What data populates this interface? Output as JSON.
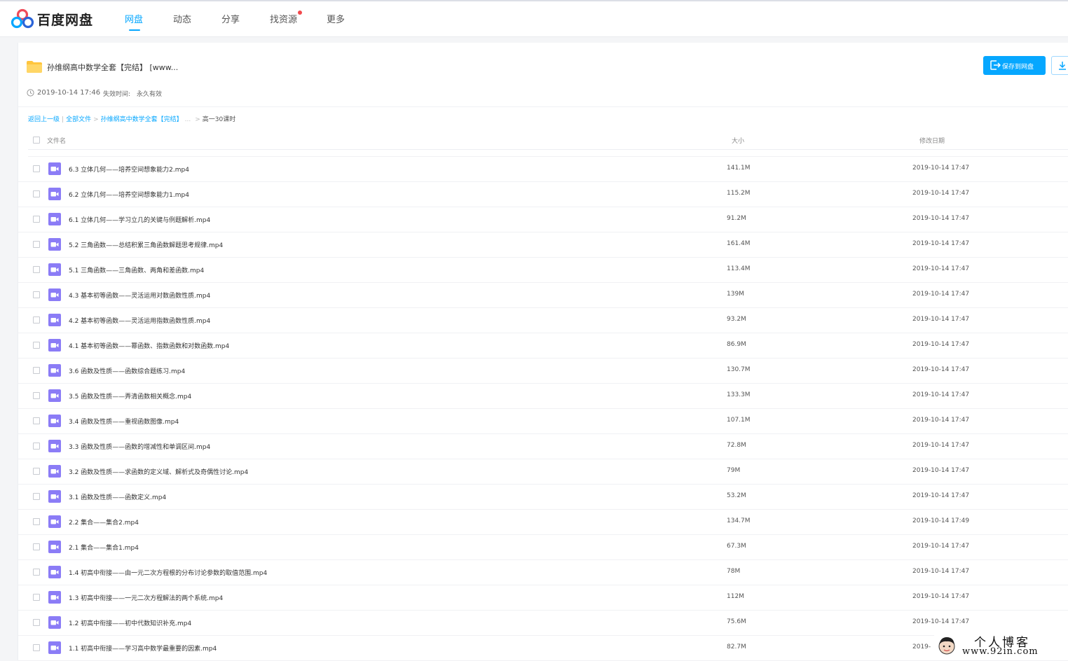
{
  "header": {
    "brand": "百度网盘",
    "nav": [
      {
        "label": "网盘",
        "active": true
      },
      {
        "label": "动态",
        "active": false
      },
      {
        "label": "分享",
        "active": false
      },
      {
        "label": "找资源",
        "active": false,
        "badge_dot": true
      },
      {
        "label": "更多",
        "active": false
      }
    ]
  },
  "share": {
    "title": "孙维纲高中数学全套【完结】 [www...",
    "date": "2019-10-14 17:46",
    "expire_label": "失效时间:",
    "expire_value": "永久有效",
    "save_button": "保存到网盘"
  },
  "breadcrumb": {
    "back": "返回上一级",
    "all": "全部文件",
    "folder": "孙维纲高中数学全套【完结】",
    "ellipsis": "...",
    "current": "高一30课时"
  },
  "columns": {
    "name": "文件名",
    "size": "大小",
    "date": "修改日期"
  },
  "files": [
    {
      "name": "6.3 立体几何——培养空间想象能力2.mp4",
      "size": "141.1M",
      "date": "2019-10-14 17:47"
    },
    {
      "name": "6.2 立体几何——培养空间想象能力1.mp4",
      "size": "115.2M",
      "date": "2019-10-14 17:47"
    },
    {
      "name": "6.1 立体几何——学习立几的关键与例题解析.mp4",
      "size": "91.2M",
      "date": "2019-10-14 17:47"
    },
    {
      "name": "5.2 三角函数——总结积累三角函数解题思考规律.mp4",
      "size": "161.4M",
      "date": "2019-10-14 17:47"
    },
    {
      "name": "5.1 三角函数——三角函数、两角和差函数.mp4",
      "size": "113.4M",
      "date": "2019-10-14 17:47"
    },
    {
      "name": "4.3 基本初等函数——灵活运用对数函数性质.mp4",
      "size": "139M",
      "date": "2019-10-14 17:47"
    },
    {
      "name": "4.2 基本初等函数——灵活运用指数函数性质.mp4",
      "size": "93.2M",
      "date": "2019-10-14 17:47"
    },
    {
      "name": "4.1 基本初等函数——幂函数、指数函数和对数函数.mp4",
      "size": "86.9M",
      "date": "2019-10-14 17:47"
    },
    {
      "name": "3.6 函数及性质——函数综合题练习.mp4",
      "size": "130.7M",
      "date": "2019-10-14 17:47"
    },
    {
      "name": "3.5 函数及性质——弄清函数相关概念.mp4",
      "size": "133.3M",
      "date": "2019-10-14 17:47"
    },
    {
      "name": "3.4 函数及性质——重视函数图像.mp4",
      "size": "107.1M",
      "date": "2019-10-14 17:47"
    },
    {
      "name": "3.3 函数及性质——函数的增减性和单调区间.mp4",
      "size": "72.8M",
      "date": "2019-10-14 17:47"
    },
    {
      "name": "3.2 函数及性质——求函数的定义域、解析式及奇偶性讨论.mp4",
      "size": "79M",
      "date": "2019-10-14 17:47"
    },
    {
      "name": "3.1 函数及性质——函数定义.mp4",
      "size": "53.2M",
      "date": "2019-10-14 17:47"
    },
    {
      "name": "2.2 集合——集合2.mp4",
      "size": "134.7M",
      "date": "2019-10-14 17:49"
    },
    {
      "name": "2.1 集合——集合1.mp4",
      "size": "67.3M",
      "date": "2019-10-14 17:47"
    },
    {
      "name": "1.4 初高中衔接——由一元二次方程根的分布讨论参数的取值范围.mp4",
      "size": "78M",
      "date": "2019-10-14 17:47"
    },
    {
      "name": "1.3 初高中衔接——一元二次方程解法的两个系统.mp4",
      "size": "112M",
      "date": "2019-10-14 17:47"
    },
    {
      "name": "1.2 初高中衔接——初中代数知识补充.mp4",
      "size": "75.6M",
      "date": "2019-10-14 17:47"
    },
    {
      "name": "1.1 初高中衔接——学习高中数学最重要的因素.mp4",
      "size": "82.7M",
      "date": "2019-"
    }
  ],
  "watermark": {
    "line1": "个人博客",
    "line2": "www.92in.com"
  },
  "colors": {
    "accent": "#06a7ff",
    "video_icon": "#8b7cf6",
    "folder": "#ffc53d",
    "badge": "#f2494c"
  }
}
